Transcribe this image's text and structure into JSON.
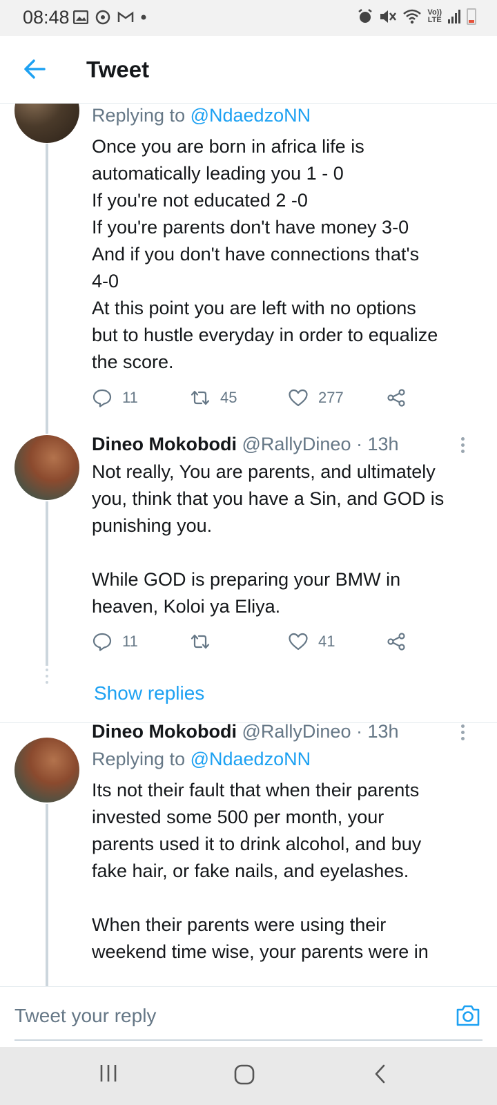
{
  "status_bar": {
    "time": "08:48",
    "network_label": "LTE",
    "volte_label": "Vo))"
  },
  "header": {
    "title": "Tweet"
  },
  "tweets": [
    {
      "replying_prefix": "Replying to ",
      "replying_handle": "@NdaedzoNN",
      "text": "Once you are born in africa life is\nautomatically leading you 1 - 0\nIf you're not educated 2 -0\nIf you're parents don't have money  3-0\nAnd if you don't have connections that's\n4-0\nAt this point you are left with no options\nbut to hustle everyday in order to equalize\nthe score.",
      "replies": "11",
      "retweets": "45",
      "likes": "277"
    },
    {
      "name": "Dineo Mokobodi",
      "meta": "@RallyDineo · 13h",
      "text": "Not really, You are parents, and ultimately\nyou, think that you have a Sin, and GOD is\npunishing you.\n\nWhile GOD is preparing your BMW in\nheaven, Koloi ya Eliya.",
      "replies": "11",
      "retweets": "",
      "likes": "41",
      "show_replies": "Show replies"
    },
    {
      "name": "Dineo Mokobodi",
      "meta": "@RallyDineo · 13h",
      "replying_prefix": "Replying to ",
      "replying_handle": "@NdaedzoNN",
      "text": "Its not their fault that when their parents\ninvested some 500 per month, your\nparents used it to drink alcohol, and buy\nfake hair, or fake nails, and eyelashes.\n\nWhen their parents were using their\nweekend time wise, your parents were in"
    }
  ],
  "reply_bar": {
    "placeholder": "Tweet your reply"
  },
  "colors": {
    "accent": "#1da1f2",
    "secondary_text": "#657786",
    "thread_line": "#ccd6dd"
  },
  "icons": {
    "back": "arrow-left-icon",
    "reply": "reply-bubble-icon",
    "retweet": "retweet-icon",
    "like": "heart-icon",
    "share": "share-icon",
    "more": "more-vertical-icon",
    "camera": "camera-icon"
  }
}
